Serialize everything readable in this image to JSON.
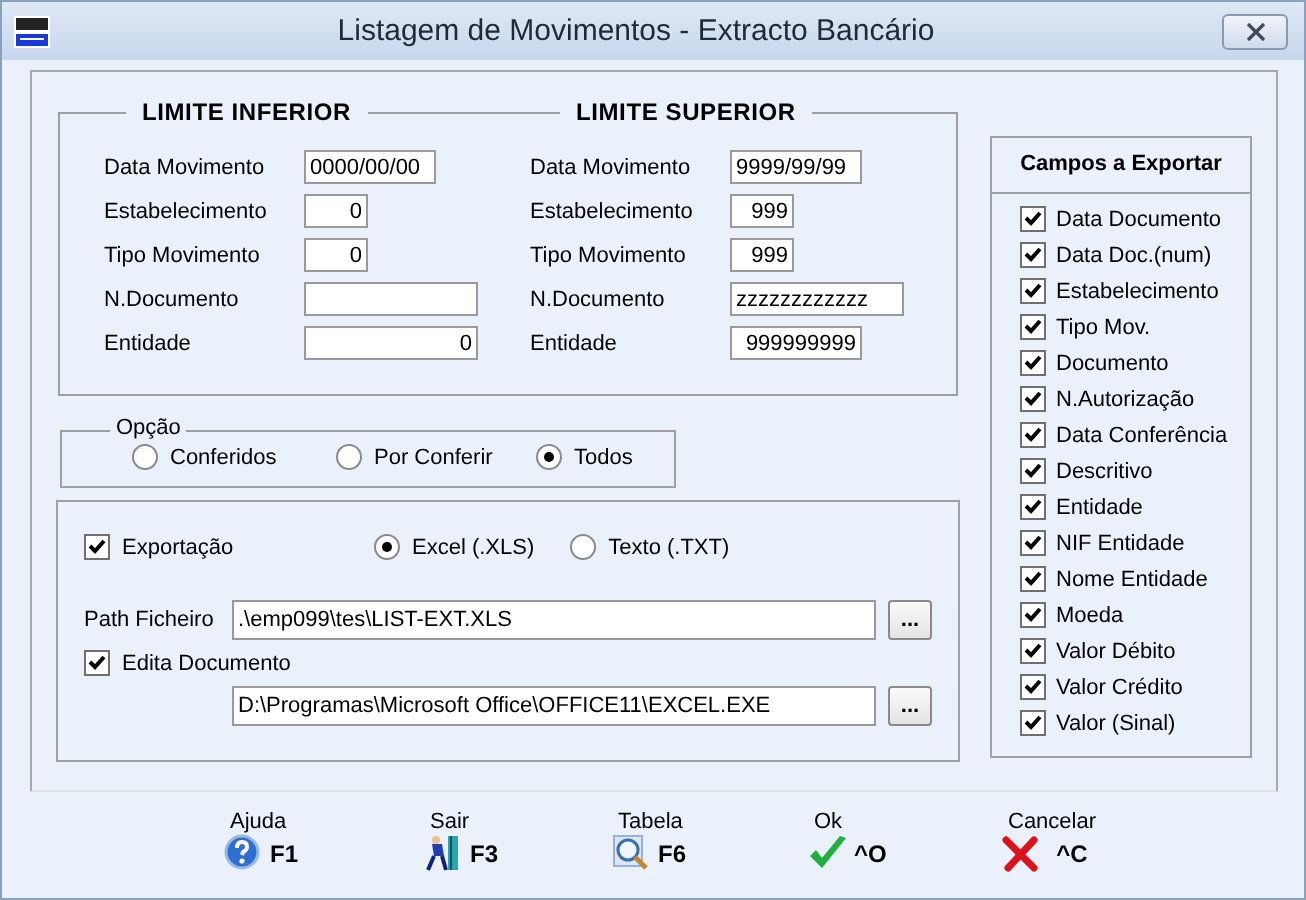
{
  "window": {
    "title": "Listagem de Movimentos - Extracto Bancário"
  },
  "limits": [
    {
      "title": "LIMITE INFERIOR",
      "fields": [
        {
          "label": "Data Movimento",
          "value": "0000/00/00",
          "kind": "date"
        },
        {
          "label": "Estabelecimento",
          "value": "0",
          "kind": "code"
        },
        {
          "label": "Tipo Movimento",
          "value": "0",
          "kind": "code"
        },
        {
          "label": "N.Documento",
          "kind": "text"
        },
        {
          "label": "Entidade",
          "value": "0",
          "kind": "amount"
        }
      ]
    },
    {
      "title": "LIMITE SUPERIOR",
      "fields": [
        {
          "label": "Data Movimento",
          "value": "9999/99/99",
          "kind": "date"
        },
        {
          "label": "Estabelecimento",
          "value": "999",
          "kind": "code"
        },
        {
          "label": "Tipo Movimento",
          "value": "999",
          "kind": "code"
        },
        {
          "label": "N.Documento",
          "value": "zzzzzzzzzzzz",
          "kind": "text"
        },
        {
          "label": "Entidade",
          "value": "999999999",
          "kind": "id"
        }
      ]
    }
  ],
  "option": {
    "title": "Opção",
    "choices": [
      {
        "label": "Conferidos",
        "selected": false
      },
      {
        "label": "Por Conferir",
        "selected": false
      },
      {
        "label": "Todos",
        "selected": true
      }
    ]
  },
  "export": {
    "enabled": {
      "label": "Exportação",
      "checked": true
    },
    "formats": [
      {
        "label": "Excel (.XLS)",
        "selected": true
      },
      {
        "label": "Texto (.TXT)",
        "selected": false
      }
    ],
    "path": {
      "label": "Path Ficheiro",
      "value": ".\\emp099\\tes\\LIST-EXT.XLS",
      "button": "..."
    },
    "edit": {
      "label": "Edita Documento",
      "checked": true
    },
    "program": {
      "value": "D:\\Programas\\Microsoft Office\\OFFICE11\\EXCEL.EXE",
      "button": "..."
    }
  },
  "fields_panel": {
    "title": "Campos a Exportar",
    "items": [
      {
        "label": "Data Documento",
        "checked": true
      },
      {
        "label": "Data Doc.(num)",
        "checked": true
      },
      {
        "label": "Estabelecimento",
        "checked": true
      },
      {
        "label": "Tipo Mov.",
        "checked": true
      },
      {
        "label": "Documento",
        "checked": true
      },
      {
        "label": "N.Autorização",
        "checked": true
      },
      {
        "label": "Data Conferência",
        "checked": true
      },
      {
        "label": "Descritivo",
        "checked": true
      },
      {
        "label": "Entidade",
        "checked": true
      },
      {
        "label": "NIF Entidade",
        "checked": true
      },
      {
        "label": "Nome Entidade",
        "checked": true
      },
      {
        "label": "Moeda",
        "checked": true
      },
      {
        "label": "Valor Débito",
        "checked": true
      },
      {
        "label": "Valor Crédito",
        "checked": true
      },
      {
        "label": "Valor (Sinal)",
        "checked": true
      }
    ]
  },
  "footer": [
    {
      "label": "Ajuda",
      "key": "F1",
      "kind": "help"
    },
    {
      "label": "Sair",
      "key": "F3",
      "kind": "exit"
    },
    {
      "label": "Tabela",
      "key": "F6",
      "kind": "table"
    },
    {
      "label": "Ok",
      "key": "^O",
      "kind": "ok"
    },
    {
      "label": "Cancelar",
      "key": "^C",
      "kind": "cancel"
    }
  ]
}
